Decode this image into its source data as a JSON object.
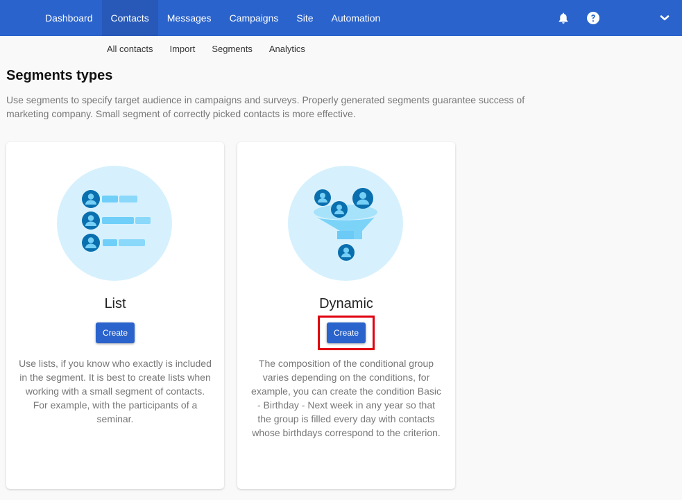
{
  "topbar": {
    "nav": [
      {
        "label": "Dashboard",
        "active": false
      },
      {
        "label": "Contacts",
        "active": true
      },
      {
        "label": "Messages",
        "active": false
      },
      {
        "label": "Campaigns",
        "active": false
      },
      {
        "label": "Site",
        "active": false
      },
      {
        "label": "Automation",
        "active": false
      }
    ],
    "icons": [
      "bell-icon",
      "help-icon",
      "chevron-down-icon"
    ],
    "colors": {
      "bar": "#2a63cc",
      "active": "#2859b8"
    }
  },
  "subnav": [
    {
      "label": "All contacts"
    },
    {
      "label": "Import"
    },
    {
      "label": "Segments"
    },
    {
      "label": "Analytics"
    }
  ],
  "page": {
    "title": "Segments types",
    "description": "Use segments to specify target audience in campaigns and surveys. Properly generated segments guarantee success of marketing company. Small segment of correctly picked contacts is more effective."
  },
  "cards": [
    {
      "title": "List",
      "button": "Create",
      "description": "Use lists, if you know who exactly is included in the segment. It is best to create lists when working with a small segment of contacts. For example, with the participants of a seminar.",
      "illustration": "contact-list-illustration"
    },
    {
      "title": "Dynamic",
      "button": "Create",
      "description": "The composition of the conditional group varies depending on the conditions, for example, you can create the condition Basic - Birthday - Next week in any year so that the group is filled every day with contacts whose birthdays correspond to the criterion.",
      "illustration": "funnel-illustration",
      "highlighted": true,
      "highlight_color": "#e0000f"
    }
  ]
}
